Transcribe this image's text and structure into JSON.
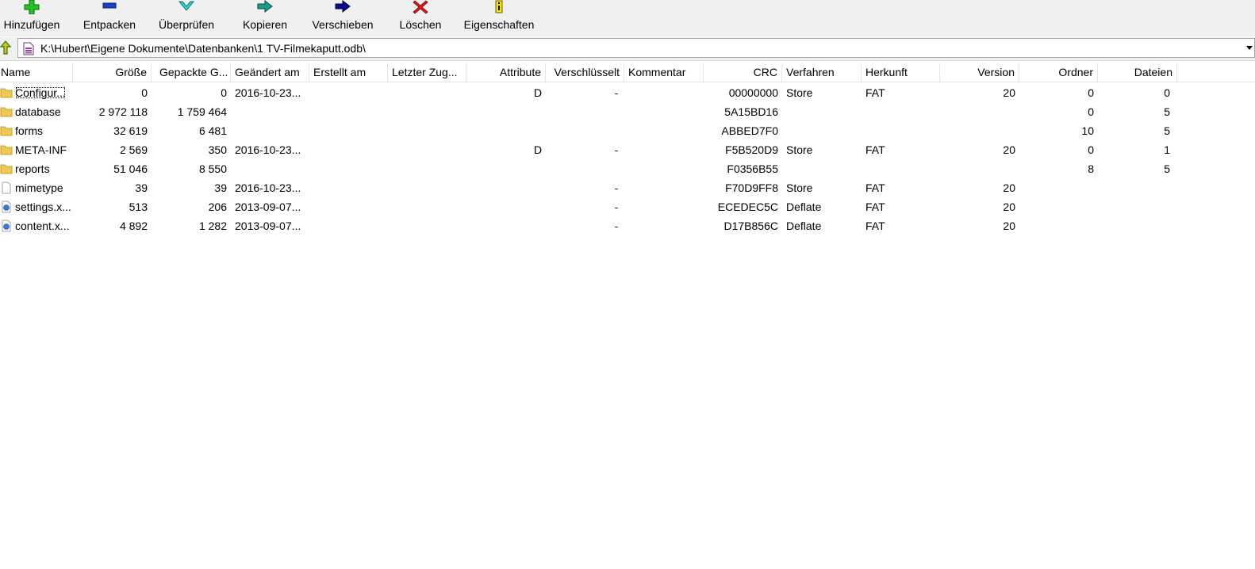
{
  "toolbar": {
    "add": "Hinzufügen",
    "extract": "Entpacken",
    "test": "Überprüfen",
    "copy": "Kopieren",
    "move": "Verschieben",
    "delete": "Löschen",
    "info": "Eigenschaften"
  },
  "address": {
    "path": "K:\\Hubert\\Eigene Dokumente\\Datenbanken\\1 TV-Filmekaputt.odb\\"
  },
  "columns": {
    "name": "Name",
    "size": "Größe",
    "packed": "Gepackte G...",
    "modified": "Geändert am",
    "created": "Erstellt am",
    "accessed": "Letzter Zug...",
    "attributes": "Attribute",
    "encrypted": "Verschlüsselt",
    "comment": "Kommentar",
    "crc": "CRC",
    "method": "Verfahren",
    "host": "Herkunft",
    "version": "Version",
    "folders": "Ordner",
    "files": "Dateien"
  },
  "rows": [
    {
      "type": "folder",
      "name": "Configur...",
      "size": "0",
      "packed": "0",
      "modified": "2016-10-23...",
      "created": "",
      "accessed": "",
      "attributes": "D",
      "encrypted": "-",
      "comment": "",
      "crc": "00000000",
      "method": "Store",
      "host": "FAT",
      "version": "20",
      "folders": "0",
      "files": "0"
    },
    {
      "type": "folder",
      "name": "database",
      "size": "2 972 118",
      "packed": "1 759 464",
      "modified": "",
      "created": "",
      "accessed": "",
      "attributes": "",
      "encrypted": "",
      "comment": "",
      "crc": "5A15BD16",
      "method": "",
      "host": "",
      "version": "",
      "folders": "0",
      "files": "5"
    },
    {
      "type": "folder",
      "name": "forms",
      "size": "32 619",
      "packed": "6 481",
      "modified": "",
      "created": "",
      "accessed": "",
      "attributes": "",
      "encrypted": "",
      "comment": "",
      "crc": "ABBED7F0",
      "method": "",
      "host": "",
      "version": "",
      "folders": "10",
      "files": "5"
    },
    {
      "type": "folder",
      "name": "META-INF",
      "size": "2 569",
      "packed": "350",
      "modified": "2016-10-23...",
      "created": "",
      "accessed": "",
      "attributes": "D",
      "encrypted": "-",
      "comment": "",
      "crc": "F5B520D9",
      "method": "Store",
      "host": "FAT",
      "version": "20",
      "folders": "0",
      "files": "1"
    },
    {
      "type": "folder",
      "name": "reports",
      "size": "51 046",
      "packed": "8 550",
      "modified": "",
      "created": "",
      "accessed": "",
      "attributes": "",
      "encrypted": "",
      "comment": "",
      "crc": "F0356B55",
      "method": "",
      "host": "",
      "version": "",
      "folders": "8",
      "files": "5"
    },
    {
      "type": "file",
      "name": "mimetype",
      "size": "39",
      "packed": "39",
      "modified": "2016-10-23...",
      "created": "",
      "accessed": "",
      "attributes": "",
      "encrypted": "-",
      "comment": "",
      "crc": "F70D9FF8",
      "method": "Store",
      "host": "FAT",
      "version": "20",
      "folders": "",
      "files": ""
    },
    {
      "type": "xml",
      "name": "settings.x...",
      "size": "513",
      "packed": "206",
      "modified": "2013-09-07...",
      "created": "",
      "accessed": "",
      "attributes": "",
      "encrypted": "-",
      "comment": "",
      "crc": "ECEDEC5C",
      "method": "Deflate",
      "host": "FAT",
      "version": "20",
      "folders": "",
      "files": ""
    },
    {
      "type": "xml",
      "name": "content.x...",
      "size": "4 892",
      "packed": "1 282",
      "modified": "2013-09-07...",
      "created": "",
      "accessed": "",
      "attributes": "",
      "encrypted": "-",
      "comment": "",
      "crc": "D17B856C",
      "method": "Deflate",
      "host": "FAT",
      "version": "20",
      "folders": "",
      "files": ""
    }
  ]
}
